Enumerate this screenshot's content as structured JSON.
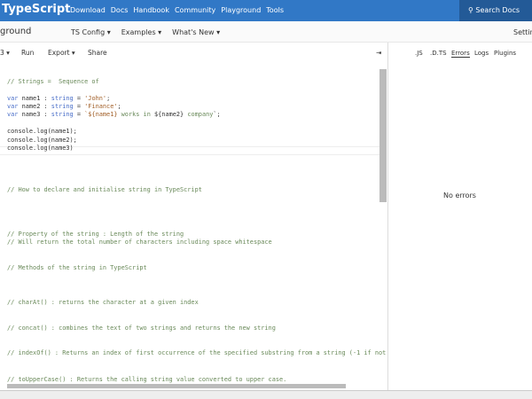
{
  "nav": {
    "brand": "TypeScript",
    "links": [
      "Download",
      "Docs",
      "Handbook",
      "Community",
      "Playground",
      "Tools"
    ],
    "search": "Search Docs",
    "search_icon": "search-icon"
  },
  "subbar": {
    "title": "ground",
    "menus": [
      "TS Config ▾",
      "Examples ▾",
      "What's New ▾"
    ],
    "settings": "Settin"
  },
  "toolbar": {
    "version": "3 ▾",
    "run": "Run",
    "export": "Export ▾",
    "share": "Share",
    "collapse": "⇥"
  },
  "right_tabs": [
    ".JS",
    ".D.TS",
    "Errors",
    "Logs",
    "Plugins"
  ],
  "right_status": "No errors",
  "code": [
    {
      "t": "// Strings =  Sequence of",
      "c": "cm"
    },
    {
      "t": "var name1 : string = 'John';",
      "c": ""
    },
    {
      "t": "var name2 : string = 'Finance';",
      "c": ""
    },
    {
      "t": "var name3 : string = `${name1} works in ${name2} company`;",
      "c": ""
    },
    {
      "t": "console.log(name1);",
      "c": ""
    },
    {
      "t": "console.log(name2);",
      "c": ""
    },
    {
      "t": "console.log(name3)",
      "c": ""
    },
    {
      "t": "// How to declare and initialise string in TypeScript",
      "c": "cm"
    },
    {
      "t": "// Property of the string : Length of the string",
      "c": "cm"
    },
    {
      "t": "// Will return the total number of characters including space whitespace",
      "c": "cm"
    },
    {
      "t": "// Methods of the string in TypeScript",
      "c": "cm"
    },
    {
      "t": "// charAt() : returns the character at a given index",
      "c": "cm"
    },
    {
      "t": "// concat() : combines the text of two strings and returns the new string",
      "c": "cm"
    },
    {
      "t": "// indexOf() : Returns an index of first occurrence of the specified substring from a string (-1 if not",
      "c": "cm"
    },
    {
      "t": "// toUpperCase() : Returns the calling string value converted to upper case.",
      "c": "cm"
    }
  ]
}
